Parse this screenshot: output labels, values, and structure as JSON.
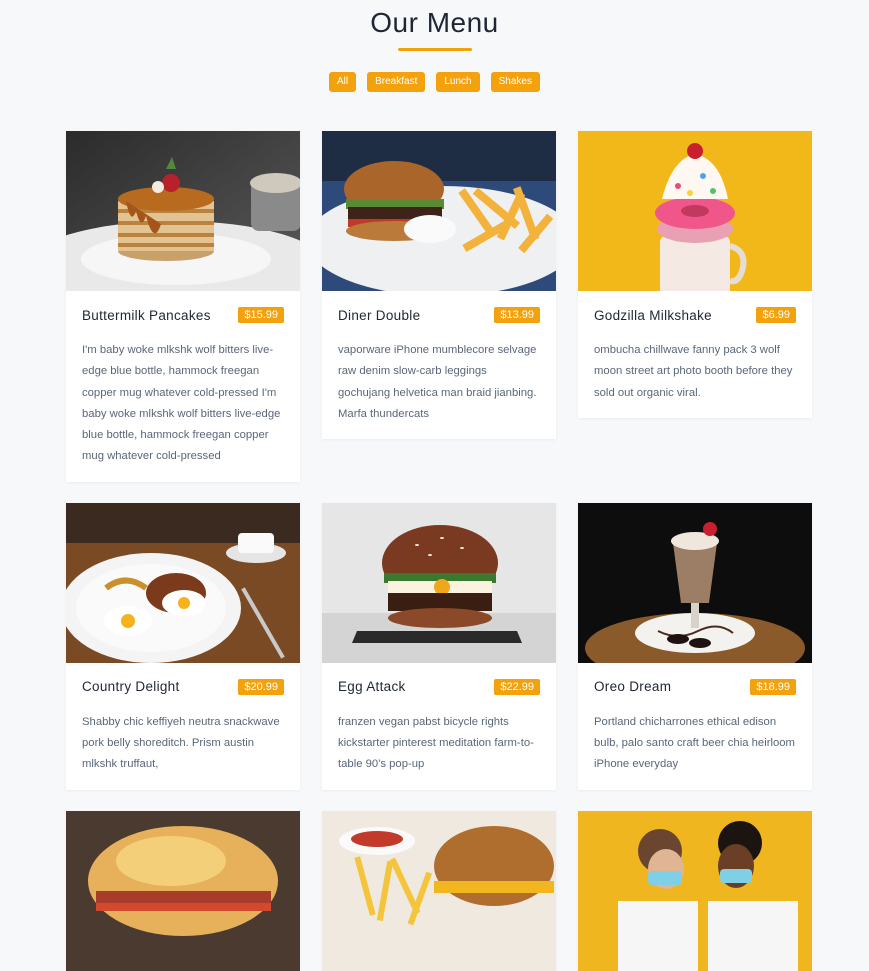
{
  "page": {
    "title": "Our Menu"
  },
  "filters": [
    "All",
    "Breakfast",
    "Lunch",
    "Shakes"
  ],
  "colors": {
    "accent": "#f4a10e",
    "background": "#f7f8fa"
  },
  "items": [
    {
      "name": "Buttermilk Pancakes",
      "price": "$15.99",
      "image": "pancakes-photo",
      "desc": "I'm baby woke mlkshk wolf bitters live-edge blue bottle, hammock freegan copper mug whatever cold-pressed I'm baby woke mlkshk wolf bitters live-edge blue bottle, hammock freegan copper mug whatever cold-pressed"
    },
    {
      "name": "Diner Double",
      "price": "$13.99",
      "image": "burger-fries-photo",
      "desc": "vaporware iPhone mumblecore selvage raw denim slow-carb leggings gochujang helvetica man braid jianbing. Marfa thundercats"
    },
    {
      "name": "Godzilla Milkshake",
      "price": "$6.99",
      "image": "milkshake-photo",
      "desc": "ombucha chillwave fanny pack 3 wolf moon street art photo booth before they sold out organic viral."
    },
    {
      "name": "Country Delight",
      "price": "$20.99",
      "image": "breakfast-plate-photo",
      "desc": "Shabby chic keffiyeh neutra snackwave pork belly shoreditch. Prism austin mlkshk truffaut,"
    },
    {
      "name": "Egg Attack",
      "price": "$22.99",
      "image": "egg-burger-photo",
      "desc": "franzen vegan pabst bicycle rights kickstarter pinterest meditation farm-to-table 90's pop-up"
    },
    {
      "name": "Oreo Dream",
      "price": "$18.99",
      "image": "oreo-shake-photo",
      "desc": "Portland chicharrones ethical edison bulb, palo santo craft beer chia heirloom iPhone everyday"
    },
    {
      "name": "",
      "price": "",
      "image": "bacon-biscuit-photo",
      "desc": ""
    },
    {
      "name": "",
      "price": "",
      "image": "burger-fries-2-photo",
      "desc": ""
    },
    {
      "name": "",
      "price": "",
      "image": "couple-milkshake-photo",
      "desc": ""
    }
  ]
}
